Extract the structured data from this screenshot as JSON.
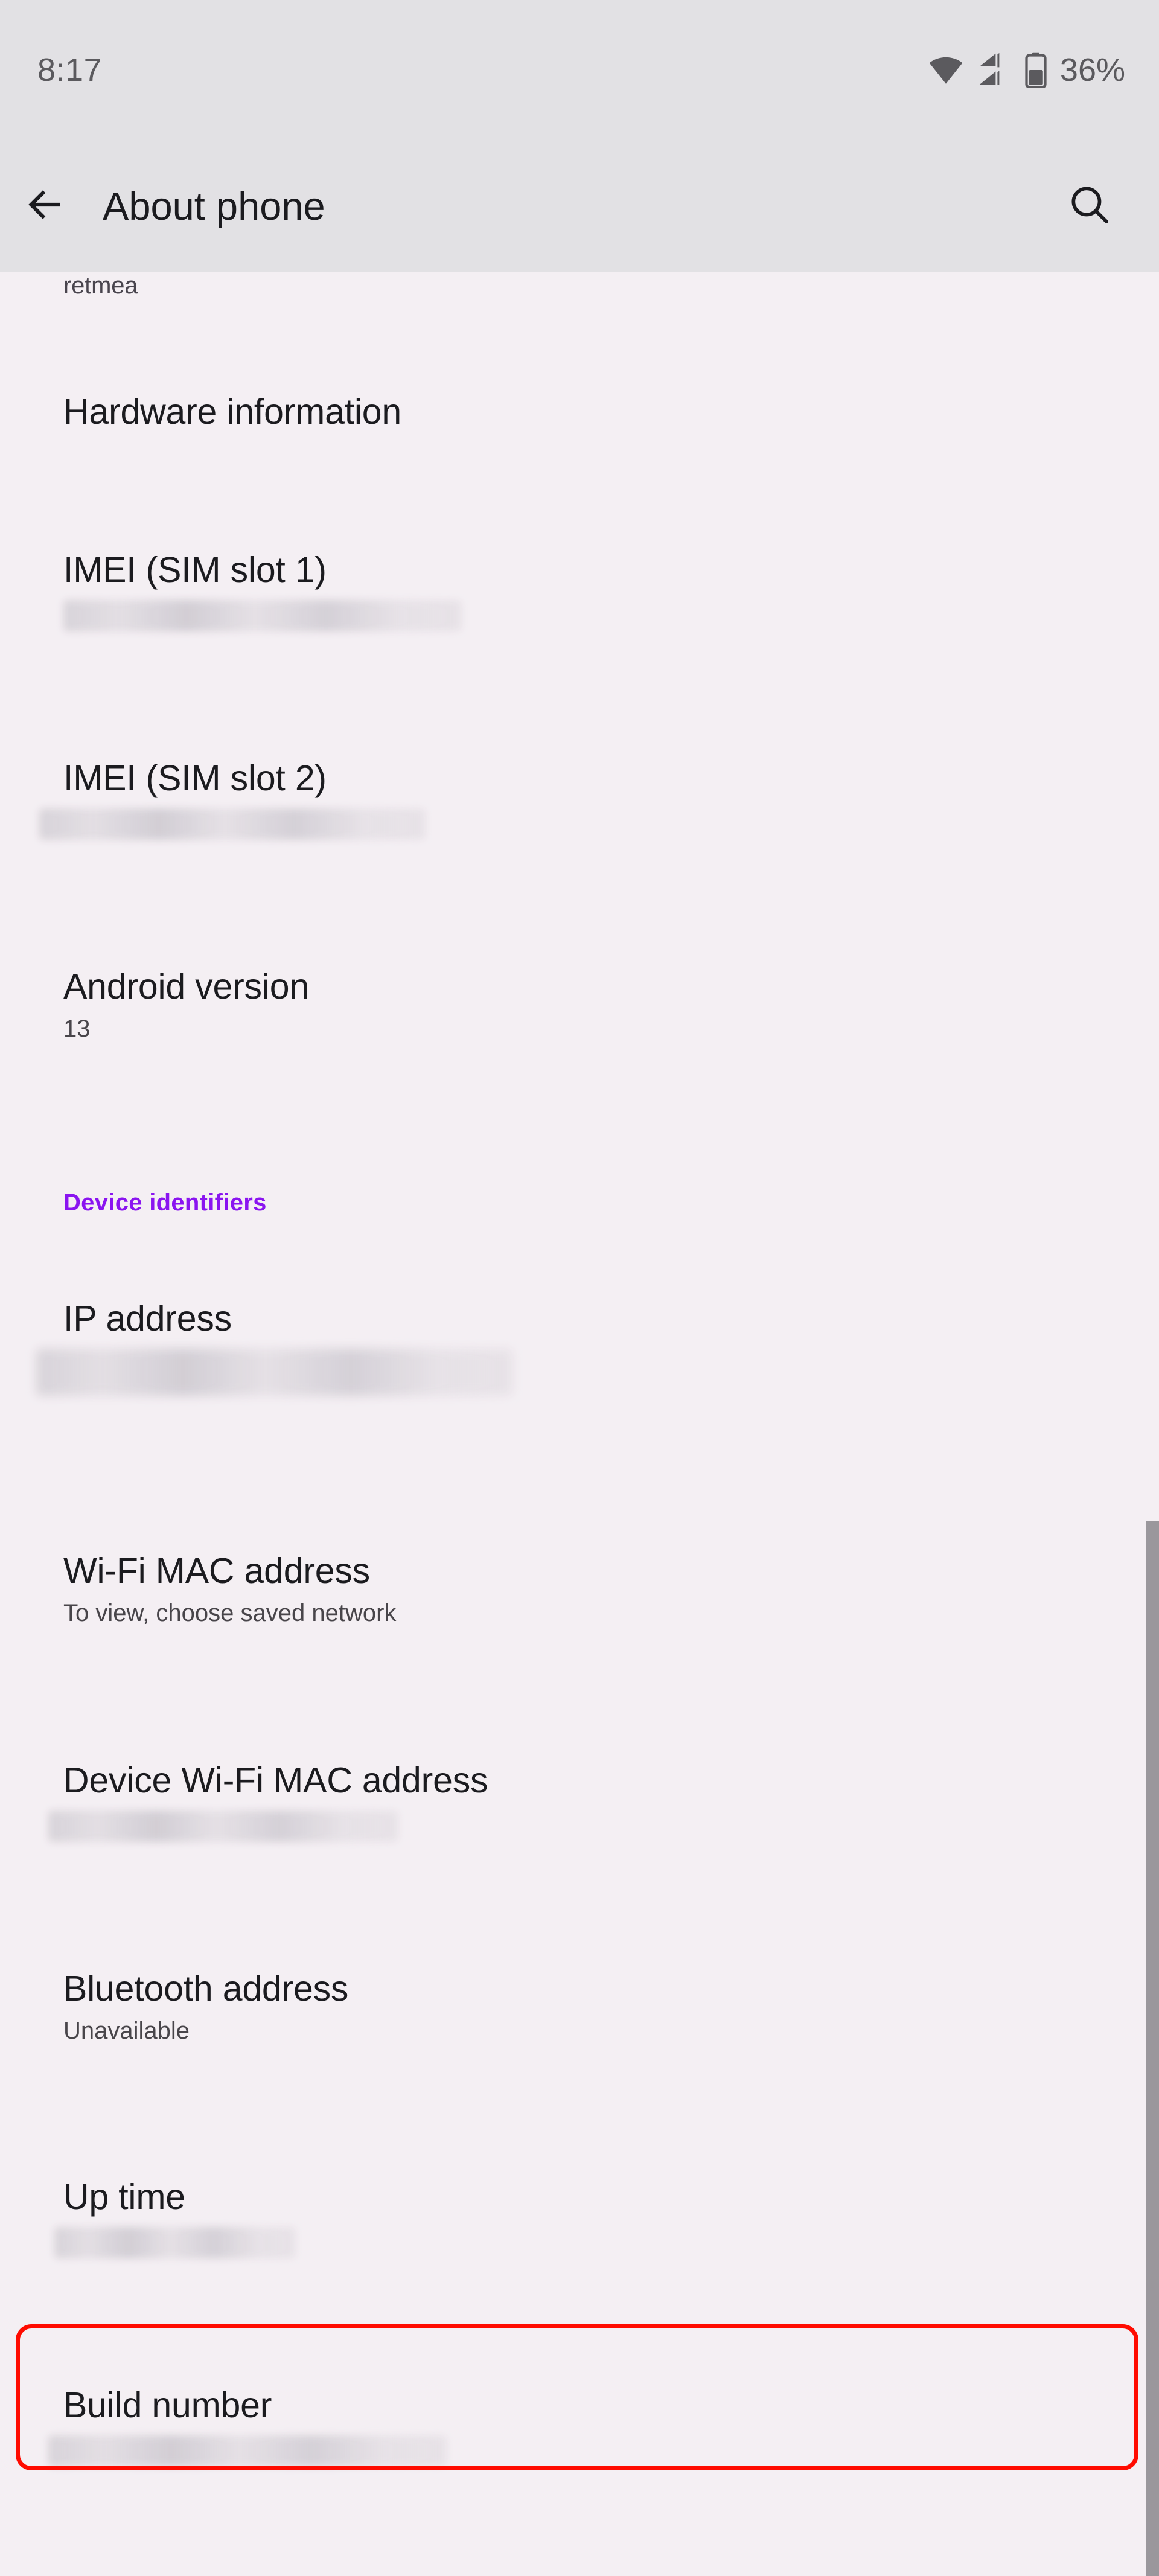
{
  "status_bar": {
    "clock": "8:17",
    "battery_percent": "36%",
    "icons": [
      "wifi-icon",
      "mobile-signal-icon",
      "battery-icon"
    ]
  },
  "app_bar": {
    "title": "About phone",
    "back_icon": "back-arrow-icon",
    "search_icon": "search-icon"
  },
  "colors": {
    "accent_purple": "#8A14F0",
    "highlight_red": "#FF0B00",
    "status_bar_bg": "#E2E1E4",
    "content_bg": "#F4EFF3",
    "primary_text": "#1B1B1F",
    "secondary_text": "#48454A",
    "scrollbar": "#9A979C"
  },
  "content": {
    "truncated_top_text": "retmea",
    "items": [
      {
        "label": "Hardware information",
        "value": "",
        "redacted": false,
        "type": "preference"
      },
      {
        "label": "IMEI (SIM slot 1)",
        "value": "",
        "redacted": true,
        "type": "preference"
      },
      {
        "label": "IMEI (SIM slot 2)",
        "value": "",
        "redacted": true,
        "type": "preference"
      },
      {
        "label": "Android version",
        "value": "13",
        "redacted": false,
        "type": "preference"
      },
      {
        "label": "Device identifiers",
        "value": "",
        "redacted": false,
        "type": "section-header"
      },
      {
        "label": "IP address",
        "value": "",
        "redacted": true,
        "type": "preference"
      },
      {
        "label": "Wi-Fi MAC address",
        "value": "To view, choose saved network",
        "redacted": false,
        "type": "preference"
      },
      {
        "label": "Device Wi-Fi MAC address",
        "value": "",
        "redacted": true,
        "type": "preference"
      },
      {
        "label": "Bluetooth address",
        "value": "Unavailable",
        "redacted": false,
        "type": "preference"
      },
      {
        "label": "Up time",
        "value": "",
        "redacted": true,
        "type": "preference"
      },
      {
        "label": "Build number",
        "value": "",
        "redacted": true,
        "type": "preference",
        "highlighted": true
      }
    ]
  }
}
